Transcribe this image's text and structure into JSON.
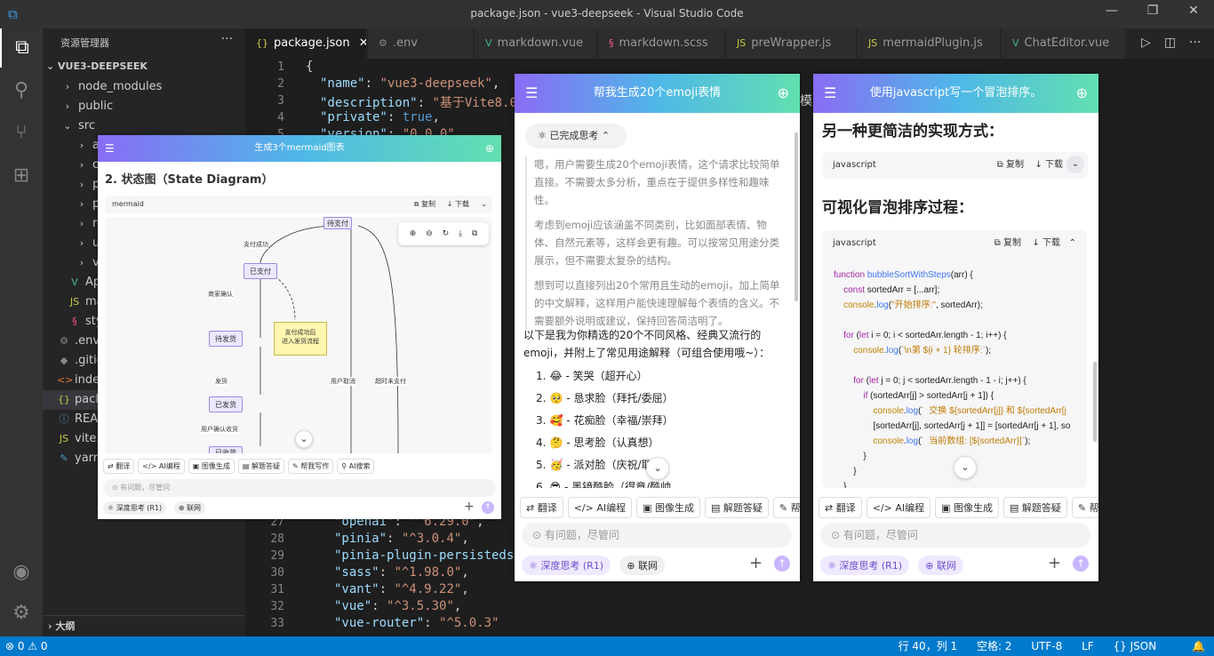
{
  "window": {
    "title": "package.json - vue3-deepseek - Visual Studio Code"
  },
  "explorer": {
    "header": "资源管理器",
    "project": "VUE3-DEEPSEEK",
    "outline": "大纲",
    "items": [
      {
        "label": "node_modules",
        "icon": "›"
      },
      {
        "label": "public",
        "icon": "›"
      },
      {
        "label": "src",
        "icon": "⌄"
      },
      {
        "label": "assets",
        "icon": "›"
      },
      {
        "label": "components",
        "icon": "›"
      },
      {
        "label": "pinia",
        "icon": "›"
      },
      {
        "label": "plugins",
        "icon": "›"
      },
      {
        "label": "router",
        "icon": "›"
      },
      {
        "label": "utils",
        "icon": "›"
      },
      {
        "label": "views",
        "icon": "›"
      },
      {
        "label": "App.vue",
        "icon": "V"
      },
      {
        "label": "main.js",
        "icon": "JS"
      },
      {
        "label": "style.scss",
        "icon": "§"
      },
      {
        "label": ".env",
        "icon": "⚙"
      },
      {
        "label": ".gitignore",
        "icon": "◆"
      },
      {
        "label": "index.html",
        "icon": "<>"
      },
      {
        "label": "package.json",
        "icon": "{}"
      },
      {
        "label": "README.md",
        "icon": "ⓘ"
      },
      {
        "label": "vite.config.js",
        "icon": "JS"
      },
      {
        "label": "yarn.lock",
        "icon": "✎"
      }
    ]
  },
  "tabs": [
    {
      "label": "package.json",
      "icon": "{}"
    },
    {
      "label": ".env",
      "icon": "⚙"
    },
    {
      "label": "markdown.vue",
      "icon": "V"
    },
    {
      "label": "markdown.scss",
      "icon": "§"
    },
    {
      "label": "preWrapper.js",
      "icon": "JS"
    },
    {
      "label": "mermaidPlugin.js",
      "icon": "JS"
    },
    {
      "label": "ChatEditor.vue",
      "icon": "V"
    }
  ],
  "code": {
    "line1": "1",
    "line2": "2",
    "line3": "3",
    "line4": "4",
    "line5": "5",
    "t1": "{",
    "k2": "\"name\"",
    "v2": "\"vue3-deepseek\"",
    "k3": "\"description\"",
    "v3": "\"基于Vite8.0+V",
    "k4": "\"private\"",
    "v4": "true",
    "k5": "\"version\"",
    "v5": "\"0.0.0\"",
    "line27": "27",
    "line28": "28",
    "line29": "29",
    "line30": "30",
    "line31": "31",
    "line32": "32",
    "line33": "33",
    "k27": "\"openai\"",
    "v27": "\"^6.29.0\"",
    "k28": "\"pinia\"",
    "v28": "\"^3.0.4\"",
    "k29": "\"pinia-plugin-persistedstat",
    "k30": "\"sass\"",
    "v30": "\"^1.98.0\"",
    "k31": "\"vant\"",
    "v31": "\"^4.9.22\"",
    "k32": "\"vue\"",
    "v32": "\"^3.5.30\"",
    "k33": "\"vue-router\"",
    "v33": "\"^5.0.3\"",
    "mo": "模"
  },
  "status": {
    "errors": "0",
    "warnings": "0",
    "position": "行 40，列 1",
    "spaces": "空格: 2",
    "encoding": "UTF-8",
    "eol": "LF",
    "lang": "JSON"
  },
  "panel1": {
    "title": "生成3个mermaid图表",
    "heading": "2. 状态图（State Diagram）",
    "lang": "mermaid",
    "copy": "复制",
    "download": "下载",
    "nodes": [
      "待支付",
      "已支付",
      "待发货",
      "已发货",
      "已收货"
    ],
    "note": "支付成功后\n进入发货流程",
    "edges": [
      "支付成功",
      "商家确认",
      "发货",
      "用户确认收货",
      "用户取消",
      "超时未支付"
    ],
    "tools": [
      "翻译",
      "AI编程",
      "图像生成",
      "解题答疑",
      "帮我写作",
      "AI搜索"
    ],
    "input": "有问题，尽管问",
    "think": "深度思考 (R1)",
    "web": "联网"
  },
  "panel2": {
    "title": "帮我生成20个emoji表情",
    "thinkdone": "已完成思考",
    "p1": "嗯，用户需要生成20个emoji表情，这个请求比较简单直接。不需要太多分析，重点在于提供多样性和趣味性。",
    "p2": "考虑到emoji应该涵盖不同类别，比如面部表情、物体、自然元素等，这样会更有趣。可以按常见用途分类展示，但不需要太复杂的结构。",
    "p3": "想到可以直接列出20个常用且生动的emoji，加上简单的中文解释，这样用户能快速理解每个表情的含义。不需要额外说明或建议，保持回答简洁明了。",
    "intro": "以下是我为你精选的20个不同风格、经典又流行的emoji，并附上了常见用途解释（可组合使用哦~）：",
    "list": [
      {
        "n": "1.",
        "e": "😂",
        "t": "- 笑哭（超开心）"
      },
      {
        "n": "2.",
        "e": "🥺",
        "t": "- 恳求脸（拜托/委屈）"
      },
      {
        "n": "3.",
        "e": "🥰",
        "t": "- 花痴脸（幸福/崇拜）"
      },
      {
        "n": "4.",
        "e": "🤔",
        "t": "- 思考脸（认真想）"
      },
      {
        "n": "5.",
        "e": "🥳",
        "t": "- 派对脸（庆祝/耶"
      },
      {
        "n": "6.",
        "e": "😎",
        "t": "- 墨镜酷脸（得意/酷帅"
      }
    ],
    "tools": [
      "翻译",
      "AI编程",
      "图像生成",
      "解题答疑",
      "帮"
    ],
    "input": "有问题，尽管问",
    "think": "深度思考 (R1)",
    "web": "联网"
  },
  "panel3": {
    "title": "使用javascript写一个冒泡排序。",
    "h1": "另一种更简洁的实现方式：",
    "h2": "可视化冒泡排序过程：",
    "lang": "javascript",
    "copy": "复制",
    "download": "下载",
    "tools": [
      "翻译",
      "AI编程",
      "图像生成",
      "解题答疑",
      "帮"
    ],
    "input": "有问题，尽管问",
    "think": "深度思考 (R1)",
    "web": "联网"
  }
}
